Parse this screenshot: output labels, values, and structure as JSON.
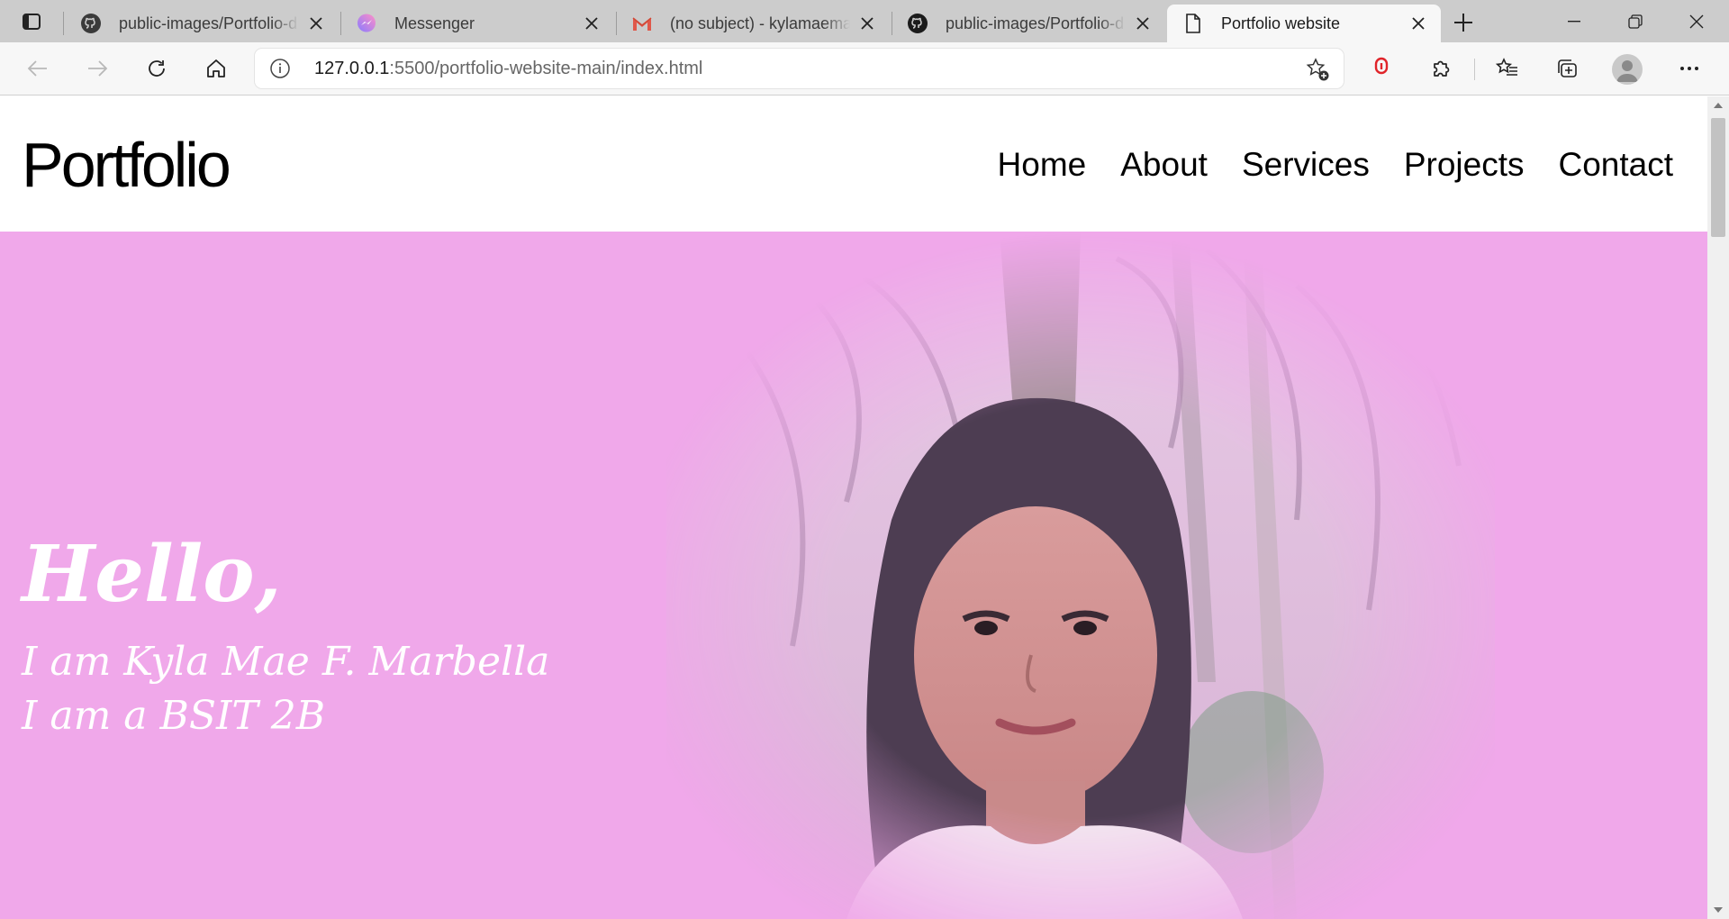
{
  "browser": {
    "tabs": [
      {
        "title": "public-images/Portfolio-d",
        "icon": "github-icon",
        "active": false
      },
      {
        "title": "Messenger",
        "icon": "messenger-icon",
        "active": false
      },
      {
        "title": "(no subject) - kylamaema",
        "icon": "gmail-icon",
        "active": false
      },
      {
        "title": "public-images/Portfolio-d",
        "icon": "github-icon",
        "active": false
      },
      {
        "title": "Portfolio website",
        "icon": "page-icon",
        "active": true
      }
    ],
    "address": {
      "host": "127.0.0.1",
      "rest": ":5500/portfolio-website-main/index.html"
    }
  },
  "site": {
    "logo": "Portfolio",
    "nav": [
      "Home",
      "About",
      "Services",
      "Projects",
      "Contact"
    ],
    "hero": {
      "greeting": "Hello,",
      "line1": "I am Kyla Mae F. Marbella",
      "line2": "I am a BSIT 2B"
    }
  },
  "colors": {
    "hero_bg": "#f0a8ea",
    "hero_text": "#ffffff",
    "tabstrip": "#cccccc",
    "toolbar": "#f7f7f7"
  }
}
